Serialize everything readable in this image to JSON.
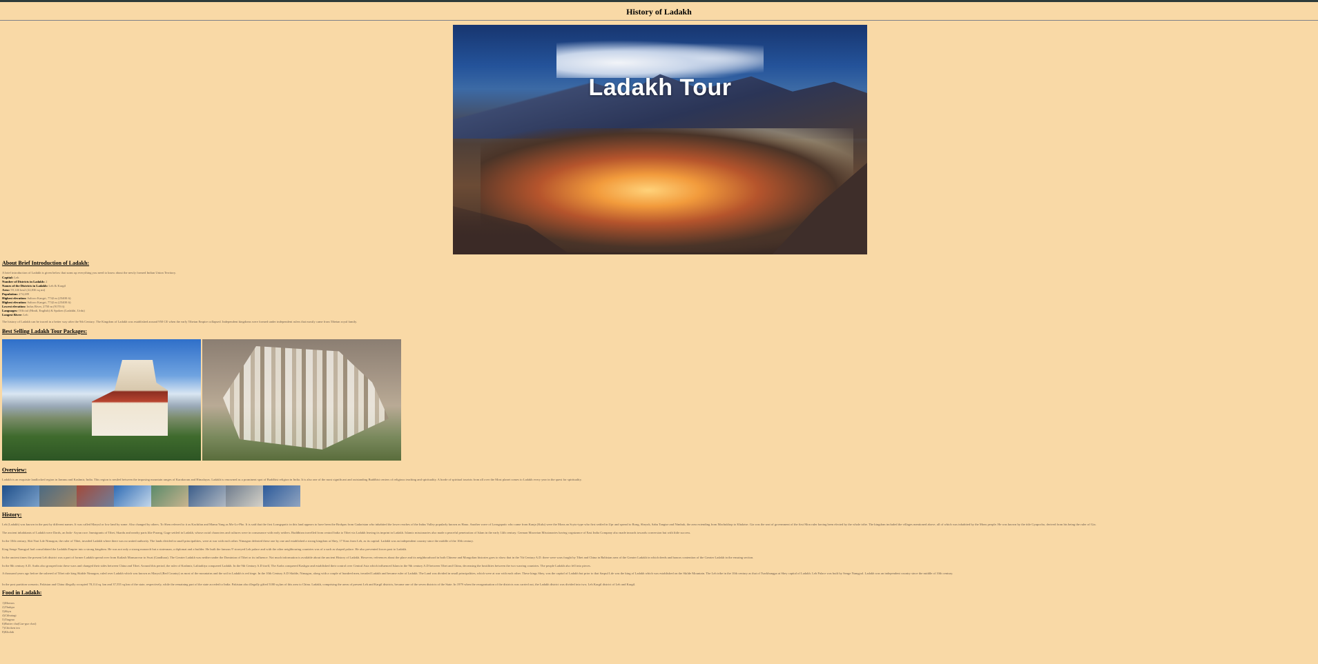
{
  "page": {
    "title": "History of Ladakh"
  },
  "hero": {
    "text": "Ladakh Tour"
  },
  "about": {
    "heading": "About Brief Introduction of Ladakh:",
    "intro": "A brief introduction of Ladakh is given below that sums up everything you need to know about the newly formed Indian Union Territory.",
    "facts": [
      {
        "label": "Capital:",
        "value": "Leh"
      },
      {
        "label": "Number of Districts in Ladakh:",
        "value": "2"
      },
      {
        "label": "Names of the Districts in Ladakh:",
        "value": "Leh & Kargil"
      },
      {
        "label": "Area:",
        "value": "59,146 km2 (22,836 sq mi)"
      },
      {
        "label": "Population:",
        "value": "274,289"
      },
      {
        "label": "Highest elevation:",
        "value": "Saltoro Kangri, 7742 m (25400 ft)"
      },
      {
        "label": "Highest elevation:",
        "value": "Saltoro Kangri, 7742 m (25400 ft)"
      },
      {
        "label": "Lowest elevation:",
        "value": "Indus River, 2750 m (9170 ft)"
      },
      {
        "label": "Languages:",
        "value": "Official (Hindi, English) & Spoken (Ladakhi, Urdu)"
      },
      {
        "label": "Longest River:",
        "value": "Leh"
      }
    ],
    "history_note": "The history of Ladakh can be traced in a better way after the 9th Century. The Kingdom of Ladakh was established around 950 CE when the early Tibetan Empire collapsed. Independent kingdoms were formed under independent rulers that mostly came from Tibetan royal family."
  },
  "packages": {
    "heading": "Best Selling Ladakh Tour Packages:"
  },
  "overview": {
    "heading": "Overview:",
    "text": "Ladakh is an exquisite landlocked region in Jammu and Kashmir, India. This region is nestled between the imposing mountain ranges of Karakoram and Himalayas. Ladakh is renowned as a prominent spot of Buddhist religion in India. It is also one of the most significant and outstanding Buddhist centers of religious teaching and spirituality. A horde of spiritual tourists from all over the Most planet comes to Ladakh every year in the quest for spirituality."
  },
  "history": {
    "heading": "History:",
    "paragraphs": [
      "Leh (Ladakh) was known in the past by different names. It was called Maryul or low land by some. Also changed by others. To Shen referred to it as Kachifan and Mamu Yang as Mo-Lo-Pho. It is said that the first Lonsgspatic in this land appears to have been the Brokpas from Gadaristan who inhabited the lower reaches of the Indus Valley popularly known as Hano. Another wave of Lonsgspatic who came from Kanja (Kulu) were the Mons an Scyto-type who first settled in Upr and spread to Rong, Sheyok, Sabu Tangtse and Nimbuk, the area extending from Machukhop to Khalatse. Gia was the seat of government of the first Mon ruler having been elected by the whole tribe. The kingdom included the villages mentioned above, all of which was inhabited by the Mons people. He was known by the title Gyapocho, derived from his being the ruler of Gia.",
      "The ancient inhabitants of Ladakh were Dards, an Indo- Aryan race. Immigrants of Tibet, Skardu and nearby parts like Purang, Guge settled in Ladakh, whose racial characters and cultures were in consonance with early settlers. Buddhism travelled from central India to Tibet via Ladakh leaving its imprint in Ladakh. Islamic missionaries also made a peaceful penetration of Islam in the early 14th century. German Moravian Missionaries having cognizance of East India Company also made inroads towards conversion but with little success.",
      "In the 10th century, Skit Nari Lde Nimagon, the ruler of Tibet, invaded Ladakh where there was no united authority. The lands divided in small principalities, were at war with each other. Nimagon defeated these one by one and established a strong kingdom at Shey, 17 Kms from Leh, as its capital. Ladakh was an independent country since the middle of the 10th century.",
      "King Senge Namgyal had consolidated the Ladakhi Empire into a strong kingdom. He was not only a strong monarch but a statesman, a diplomat and a builder. He built the famous 9' storeyed Leh palace and with the other neighbouring countries was of a such as shaped palace. He also prevented forces past to Ladakh.",
      "In the ancient times the present Leh district was a part of former Ladakh spread over from Kailash Mansarovar to Swat (Gandhara). The Greater Ladakh was neither under the Dominion of Tibet or its influence. Not much information is available about the ancient History of Ladakh. However, references about the place and its neighbourhood in both Chinese and Mongolian histories goes to show that in the 7th Century A.D. there were wars fought by Tibet and China in Baltistan area of the Greater Ladakh in which deeds and honors contention of the Greater Ladakh in the ensuing section.",
      "In the 8th century A.D. Arabs also grouped into these wars and changed their sides between China and Tibet. Around this period, the ruler of Kashmir, Lalitaditya conquered Ladakh. In the 9th Century A.D itself, The Arabs conquered Kashgar and established their control over Central Asia which influenced Islam in the 9th century A.D between Tibet and China, decreasing the hostilities between the two warring countries. The people Ladakh also fell into pieces.",
      "A thousand years ago before the ushered of Tibet rule king Skidde Nimagon, ruled over Ladakh which was known as Maryul (Red Country) as most of the mountains and the soil in Ladakh is red tinge. In the 10th Century A.D Skidde, Nimagon, along with a couple of hundred men, invaded Ladakh and became ruler of Ladakh. The Land was divided in small principalities, which were at war with each other. These kings Shey, was the capital of Ladakh but prior to that Saspul Lde was the king of Ladakh which was established on the Skilde Mountain. The Leh tribe in the 10th century as that of Tsarkhungpa at Shey capital of Ladakh. Leh Palace was built by Senge Namgyal. Ladakh was an independent country since the middle of 10th century.",
      "In the post partition scenario, Pakistan and China illegally occupied 78,114 sq. km and 37,555 sq.km of the state, respectively, while the remaining part of the state acceded to India. Pakistan also illegally gifted 5180 sq.km of this area to China. Ladakh, comprising the areas of present Leh and Kargil districts, became one of the seven districts of the State. In 1979 when the reorganisation of the districts was carried out, the Ladakh district was divided into two; Leh Kargil district of Leh and Kargil."
    ]
  },
  "food": {
    "heading": "Food in Ladakh:",
    "items": [
      "1)Momos",
      "2)Thukpa",
      "3)Skyu",
      "4)Chhutagi",
      "5)Tingmo",
      "6)Butter cha(Gur-gur chai)",
      "7)Chicken tea",
      "8)Kholak"
    ]
  },
  "colors": {
    "background": "#f9d9a6",
    "topbar": "#2e3b3a",
    "text": "#6b5c4f"
  }
}
